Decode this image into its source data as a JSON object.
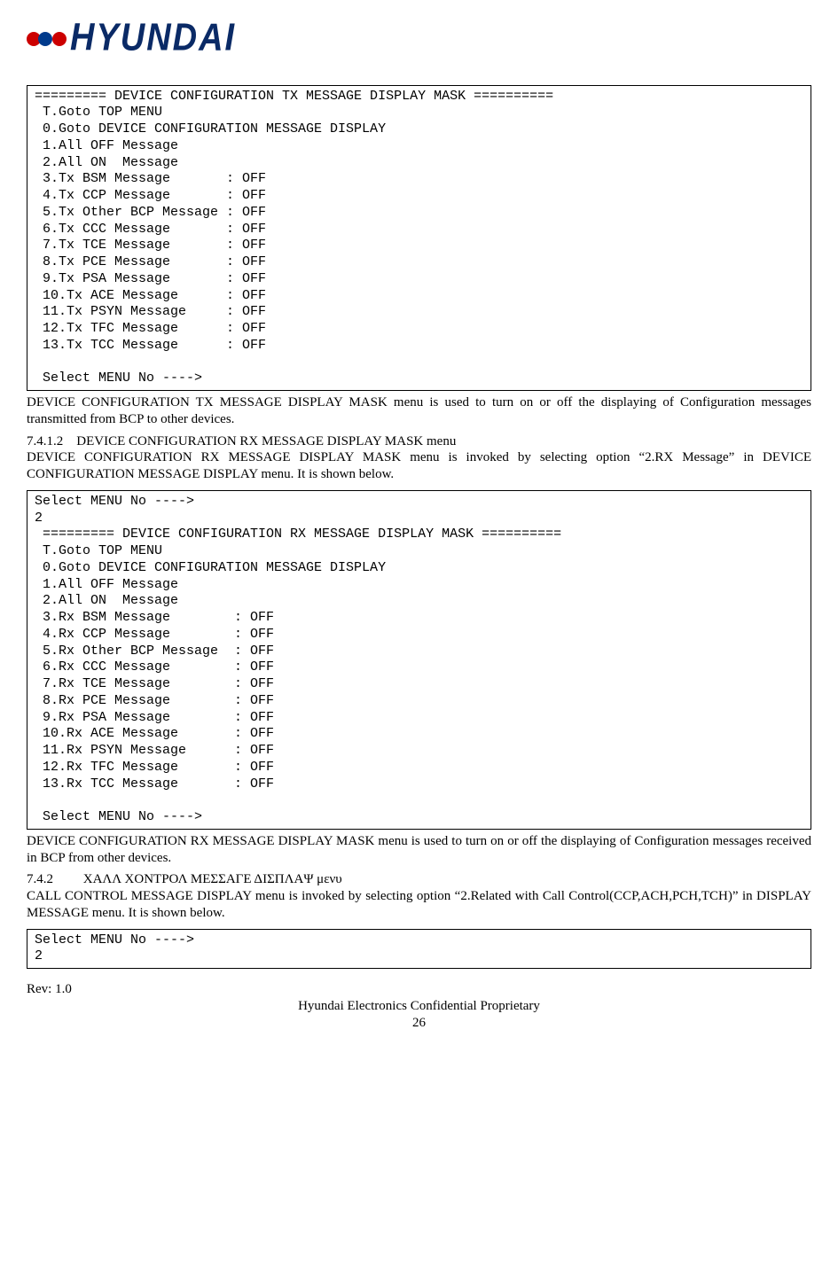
{
  "header": {
    "brand": "HYUNDAI"
  },
  "term_tx": "========= DEVICE CONFIGURATION TX MESSAGE DISPLAY MASK ==========\n T.Goto TOP MENU\n 0.Goto DEVICE CONFIGURATION MESSAGE DISPLAY\n 1.All OFF Message\n 2.All ON  Message\n 3.Tx BSM Message       : OFF\n 4.Tx CCP Message       : OFF\n 5.Tx Other BCP Message : OFF\n 6.Tx CCC Message       : OFF\n 7.Tx TCE Message       : OFF\n 8.Tx PCE Message       : OFF\n 9.Tx PSA Message       : OFF\n 10.Tx ACE Message      : OFF\n 11.Tx PSYN Message     : OFF\n 12.Tx TFC Message      : OFF\n 13.Tx TCC Message      : OFF\n\n Select MENU No ---->",
  "para_tx": "DEVICE CONFIGURATION TX MESSAGE DISPLAY MASK menu is used to turn on or off the displaying of Configuration messages transmitted from BCP to other devices.",
  "sec_rx": {
    "num": "7.4.1.2",
    "title": "DEVICE CONFIGURATION RX MESSAGE DISPLAY MASK menu"
  },
  "para_rx_intro": "DEVICE CONFIGURATION RX MESSAGE DISPLAY MASK menu is invoked by selecting option “2.RX Message” in DEVICE CONFIGURATION MESSAGE DISPLAY menu. It is shown below.",
  "term_rx": "Select MENU No ---->\n2\n ========= DEVICE CONFIGURATION RX MESSAGE DISPLAY MASK ==========\n T.Goto TOP MENU\n 0.Goto DEVICE CONFIGURATION MESSAGE DISPLAY\n 1.All OFF Message\n 2.All ON  Message\n 3.Rx BSM Message        : OFF\n 4.Rx CCP Message        : OFF\n 5.Rx Other BCP Message  : OFF\n 6.Rx CCC Message        : OFF\n 7.Rx TCE Message        : OFF\n 8.Rx PCE Message        : OFF\n 9.Rx PSA Message        : OFF\n 10.Rx ACE Message       : OFF\n 11.Rx PSYN Message      : OFF\n 12.Rx TFC Message       : OFF\n 13.Rx TCC Message       : OFF\n\n Select MENU No ---->",
  "para_rx_out": "DEVICE CONFIGURATION RX MESSAGE DISPLAY MASK menu is used to turn on or off the displaying of Configuration messages received in BCP from other devices.",
  "sec_cc": {
    "num": "7.4.2",
    "title": "ΧΑΛΛ ΧΟΝΤΡΟΛ ΜΕΣΣΑΓΕ ΔΙΣΠΛΑΨ μενυ"
  },
  "para_cc": "CALL CONTROL MESSAGE DISPLAY menu is invoked by selecting option “2.Related with Call Control(CCP,ACH,PCH,TCH)” in DISPLAY MESSAGE menu. It is shown below.",
  "term_cc": "Select MENU No ---->\n2",
  "footer": {
    "rev": "Rev: 1.0",
    "confidential": "Hyundai Electronics Confidential Proprietary",
    "page": "26"
  }
}
